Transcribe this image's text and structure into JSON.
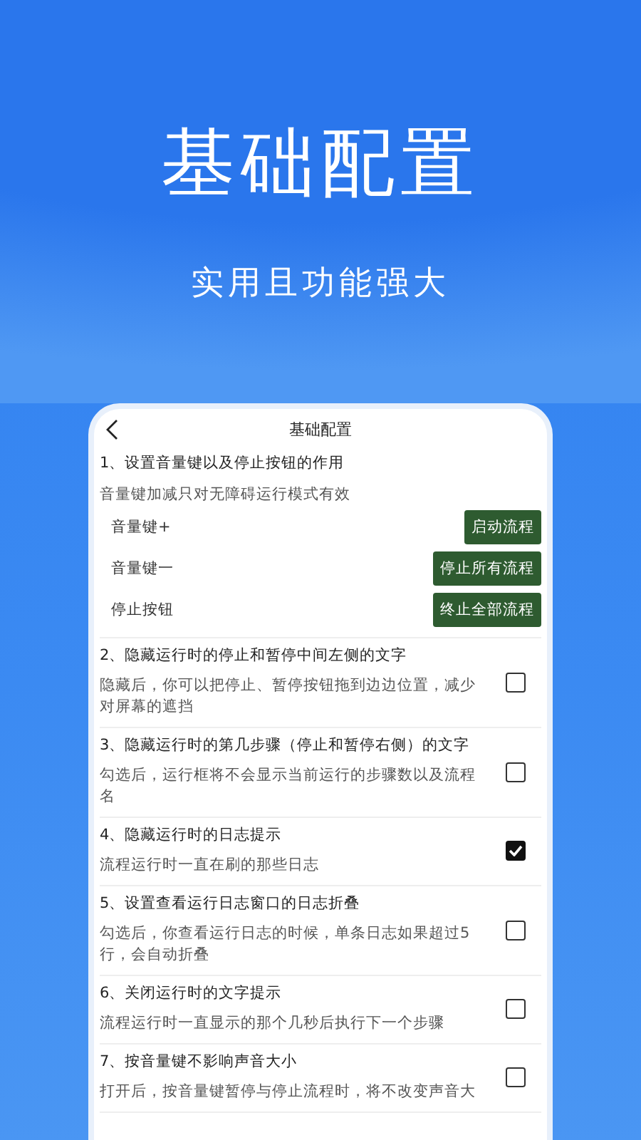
{
  "hero": {
    "title": "基础配置",
    "subtitle": "实用且功能强大"
  },
  "phone": {
    "header": {
      "title": "基础配置"
    },
    "section": {
      "title": "1、设置音量键以及停止按钮的作用",
      "note": "音量键加减只对无障碍运行模式有效",
      "rows": [
        {
          "label": "音量键+",
          "button": "启动流程"
        },
        {
          "label": "音量键一",
          "button": "停止所有流程"
        },
        {
          "label": "停止按钮",
          "button": "终止全部流程"
        }
      ]
    },
    "options": [
      {
        "title": "2、隐藏运行时的停止和暂停中间左侧的文字",
        "description": "隐藏后，你可以把停止、暂停按钮拖到边边位置，减少对屏幕的遮挡",
        "checked": false
      },
      {
        "title": "3、隐藏运行时的第几步骤（停止和暂停右侧）的文字",
        "description": "勾选后，运行框将不会显示当前运行的步骤数以及流程名",
        "checked": false
      },
      {
        "title": "4、隐藏运行时的日志提示",
        "description": "流程运行时一直在刷的那些日志",
        "checked": true
      },
      {
        "title": "5、设置查看运行日志窗口的日志折叠",
        "description": "勾选后，你查看运行日志的时候，单条日志如果超过5行，会自动折叠",
        "checked": false
      },
      {
        "title": "6、关闭运行时的文字提示",
        "description": "流程运行时一直显示的那个几秒后执行下一个步骤",
        "checked": false
      },
      {
        "title": "7、按音量键不影响声音大小",
        "description": "打开后，按音量键暂停与停止流程时，将不改变声音大",
        "checked": false
      }
    ]
  }
}
